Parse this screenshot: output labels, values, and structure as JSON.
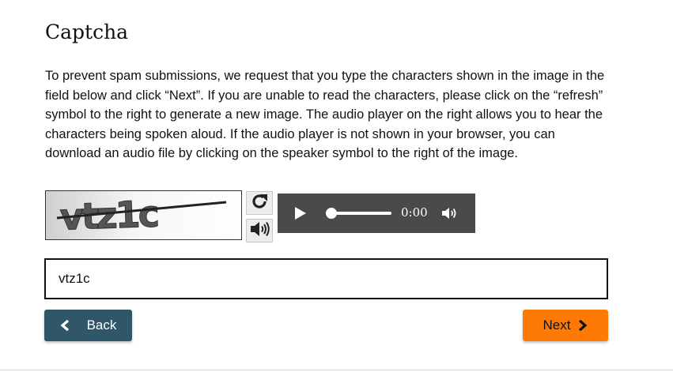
{
  "page": {
    "title": "Captcha",
    "intro": "To prevent spam submissions, we request that you type the characters shown in the image in the field below and click “Next”. If you are unable to read the characters, please click on the “refresh” symbol to the right to generate a new image. The audio player on the right allows you to hear the characters being spoken aloud. If the audio player is not shown in your browser, you can download an audio file by clicking on the speaker symbol to the right of the image."
  },
  "captcha": {
    "image_text": "vtz1c",
    "refresh_icon": "refresh-icon",
    "speaker_icon": "speaker-icon"
  },
  "audio_player": {
    "time": "0:00",
    "progress": 0,
    "play_icon": "play-icon",
    "volume_icon": "volume-icon"
  },
  "answer": {
    "value": "vtz1c"
  },
  "buttons": {
    "back_label": "Back",
    "next_label": "Next"
  },
  "colors": {
    "back_button": "#2f5768",
    "next_button": "#ff7a05",
    "audio_player_bg": "#4a4a4a"
  }
}
